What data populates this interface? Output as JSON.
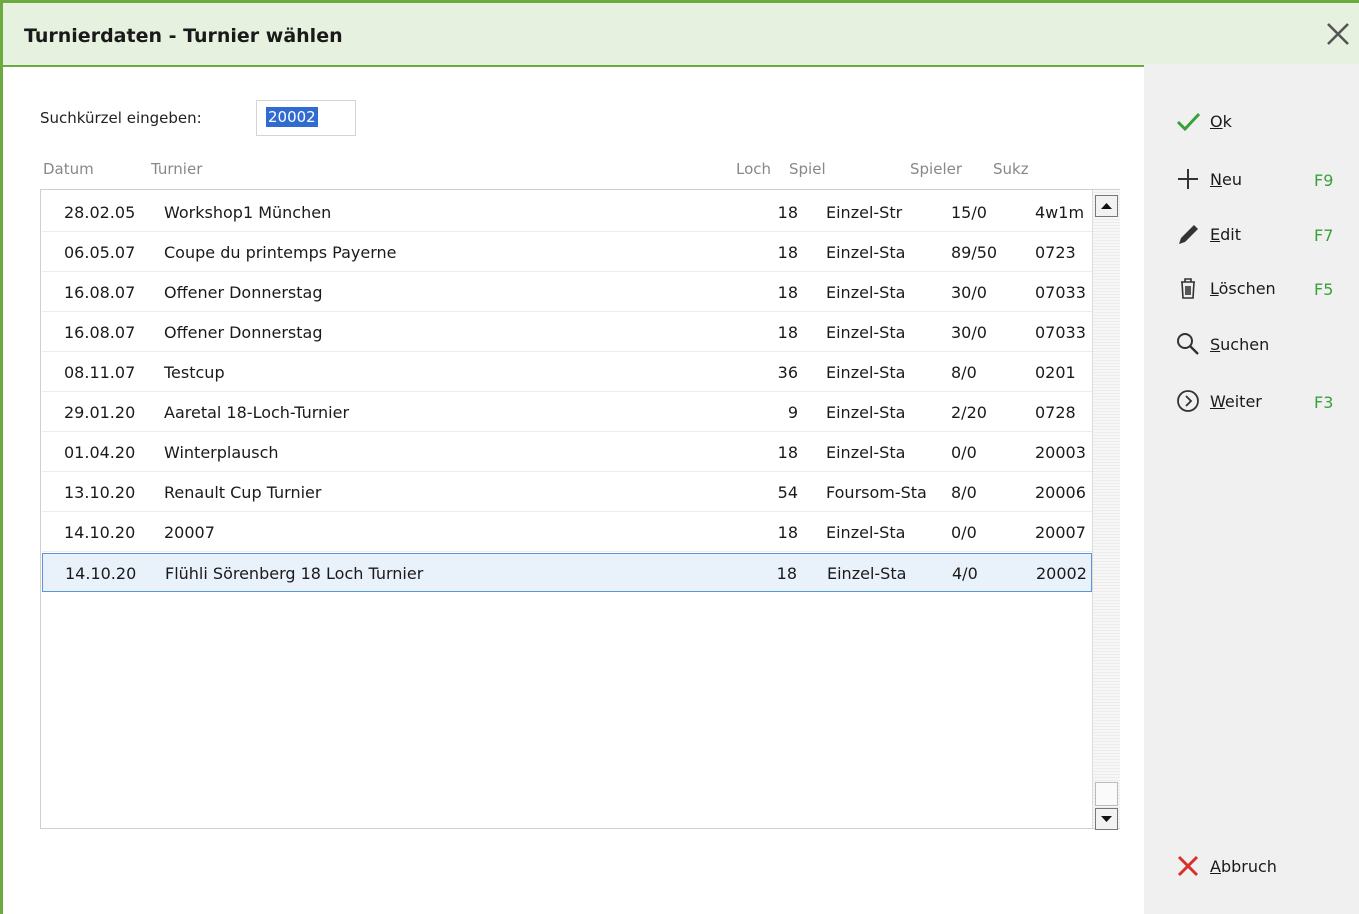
{
  "window": {
    "title": "Turnierdaten - Turnier wählen"
  },
  "search": {
    "label": "Suchkürzel eingeben:",
    "value": "20002"
  },
  "columns": {
    "datum": "Datum",
    "turnier": "Turnier",
    "loch": "Loch",
    "spiel": "Spiel",
    "spieler": "Spieler",
    "sukz": "Sukz"
  },
  "rows": [
    {
      "datum": "28.02.05",
      "turnier": "Workshop1 München",
      "loch": "18",
      "spiel": "Einzel-Str",
      "spieler": "15/0",
      "sukz": "4w1m"
    },
    {
      "datum": "06.05.07",
      "turnier": "Coupe du printemps Payerne",
      "loch": "18",
      "spiel": "Einzel-Sta",
      "spieler": "89/50",
      "sukz": "0723"
    },
    {
      "datum": "16.08.07",
      "turnier": "Offener Donnerstag",
      "loch": "18",
      "spiel": "Einzel-Sta",
      "spieler": "30/0",
      "sukz": "07033"
    },
    {
      "datum": "16.08.07",
      "turnier": "Offener Donnerstag",
      "loch": "18",
      "spiel": "Einzel-Sta",
      "spieler": "30/0",
      "sukz": "07033"
    },
    {
      "datum": "08.11.07",
      "turnier": "Testcup",
      "loch": "36",
      "spiel": "Einzel-Sta",
      "spieler": "8/0",
      "sukz": "0201"
    },
    {
      "datum": "29.01.20",
      "turnier": "Aaretal 18-Loch-Turnier",
      "loch": "9",
      "spiel": "Einzel-Sta",
      "spieler": "2/20",
      "sukz": "0728"
    },
    {
      "datum": "01.04.20",
      "turnier": "Winterplausch",
      "loch": "18",
      "spiel": "Einzel-Sta",
      "spieler": "0/0",
      "sukz": "20003"
    },
    {
      "datum": "13.10.20",
      "turnier": "Renault Cup Turnier",
      "loch": "54",
      "spiel": "Foursom-Sta",
      "spieler": "8/0",
      "sukz": "20006"
    },
    {
      "datum": "14.10.20",
      "turnier": "20007",
      "loch": "18",
      "spiel": "Einzel-Sta",
      "spieler": "0/0",
      "sukz": "20007"
    },
    {
      "datum": "14.10.20",
      "turnier": "Flühli Sörenberg 18 Loch Turnier",
      "loch": "18",
      "spiel": "Einzel-Sta",
      "spieler": "4/0",
      "sukz": "20002",
      "selected": true
    }
  ],
  "sidebar": {
    "ok": {
      "key": "O",
      "rest": "k",
      "fkey": "",
      "icon": "check-icon",
      "color": "#3aa03a"
    },
    "neu": {
      "key": "N",
      "rest": "eu",
      "fkey": "F9",
      "icon": "plus-icon"
    },
    "edit": {
      "key": "E",
      "rest": "dit",
      "fkey": "F7",
      "icon": "pencil-icon"
    },
    "loeschen": {
      "key": "L",
      "rest": "öschen",
      "fkey": "F5",
      "icon": "trash-icon"
    },
    "suchen": {
      "key": "S",
      "rest": "uchen",
      "fkey": "",
      "icon": "search-icon"
    },
    "weiter": {
      "key": "W",
      "rest": "eiter",
      "fkey": "F3",
      "icon": "arrow-circle-icon"
    },
    "abbruch": {
      "key": "A",
      "rest": "bbruch",
      "fkey": "",
      "icon": "cross-icon",
      "color": "#d9302a"
    }
  },
  "colors": {
    "accent": "#6aaa3e",
    "titlebar": "#e6f1df",
    "selection": "#2f6bd0",
    "fkey": "#3aa03a"
  }
}
